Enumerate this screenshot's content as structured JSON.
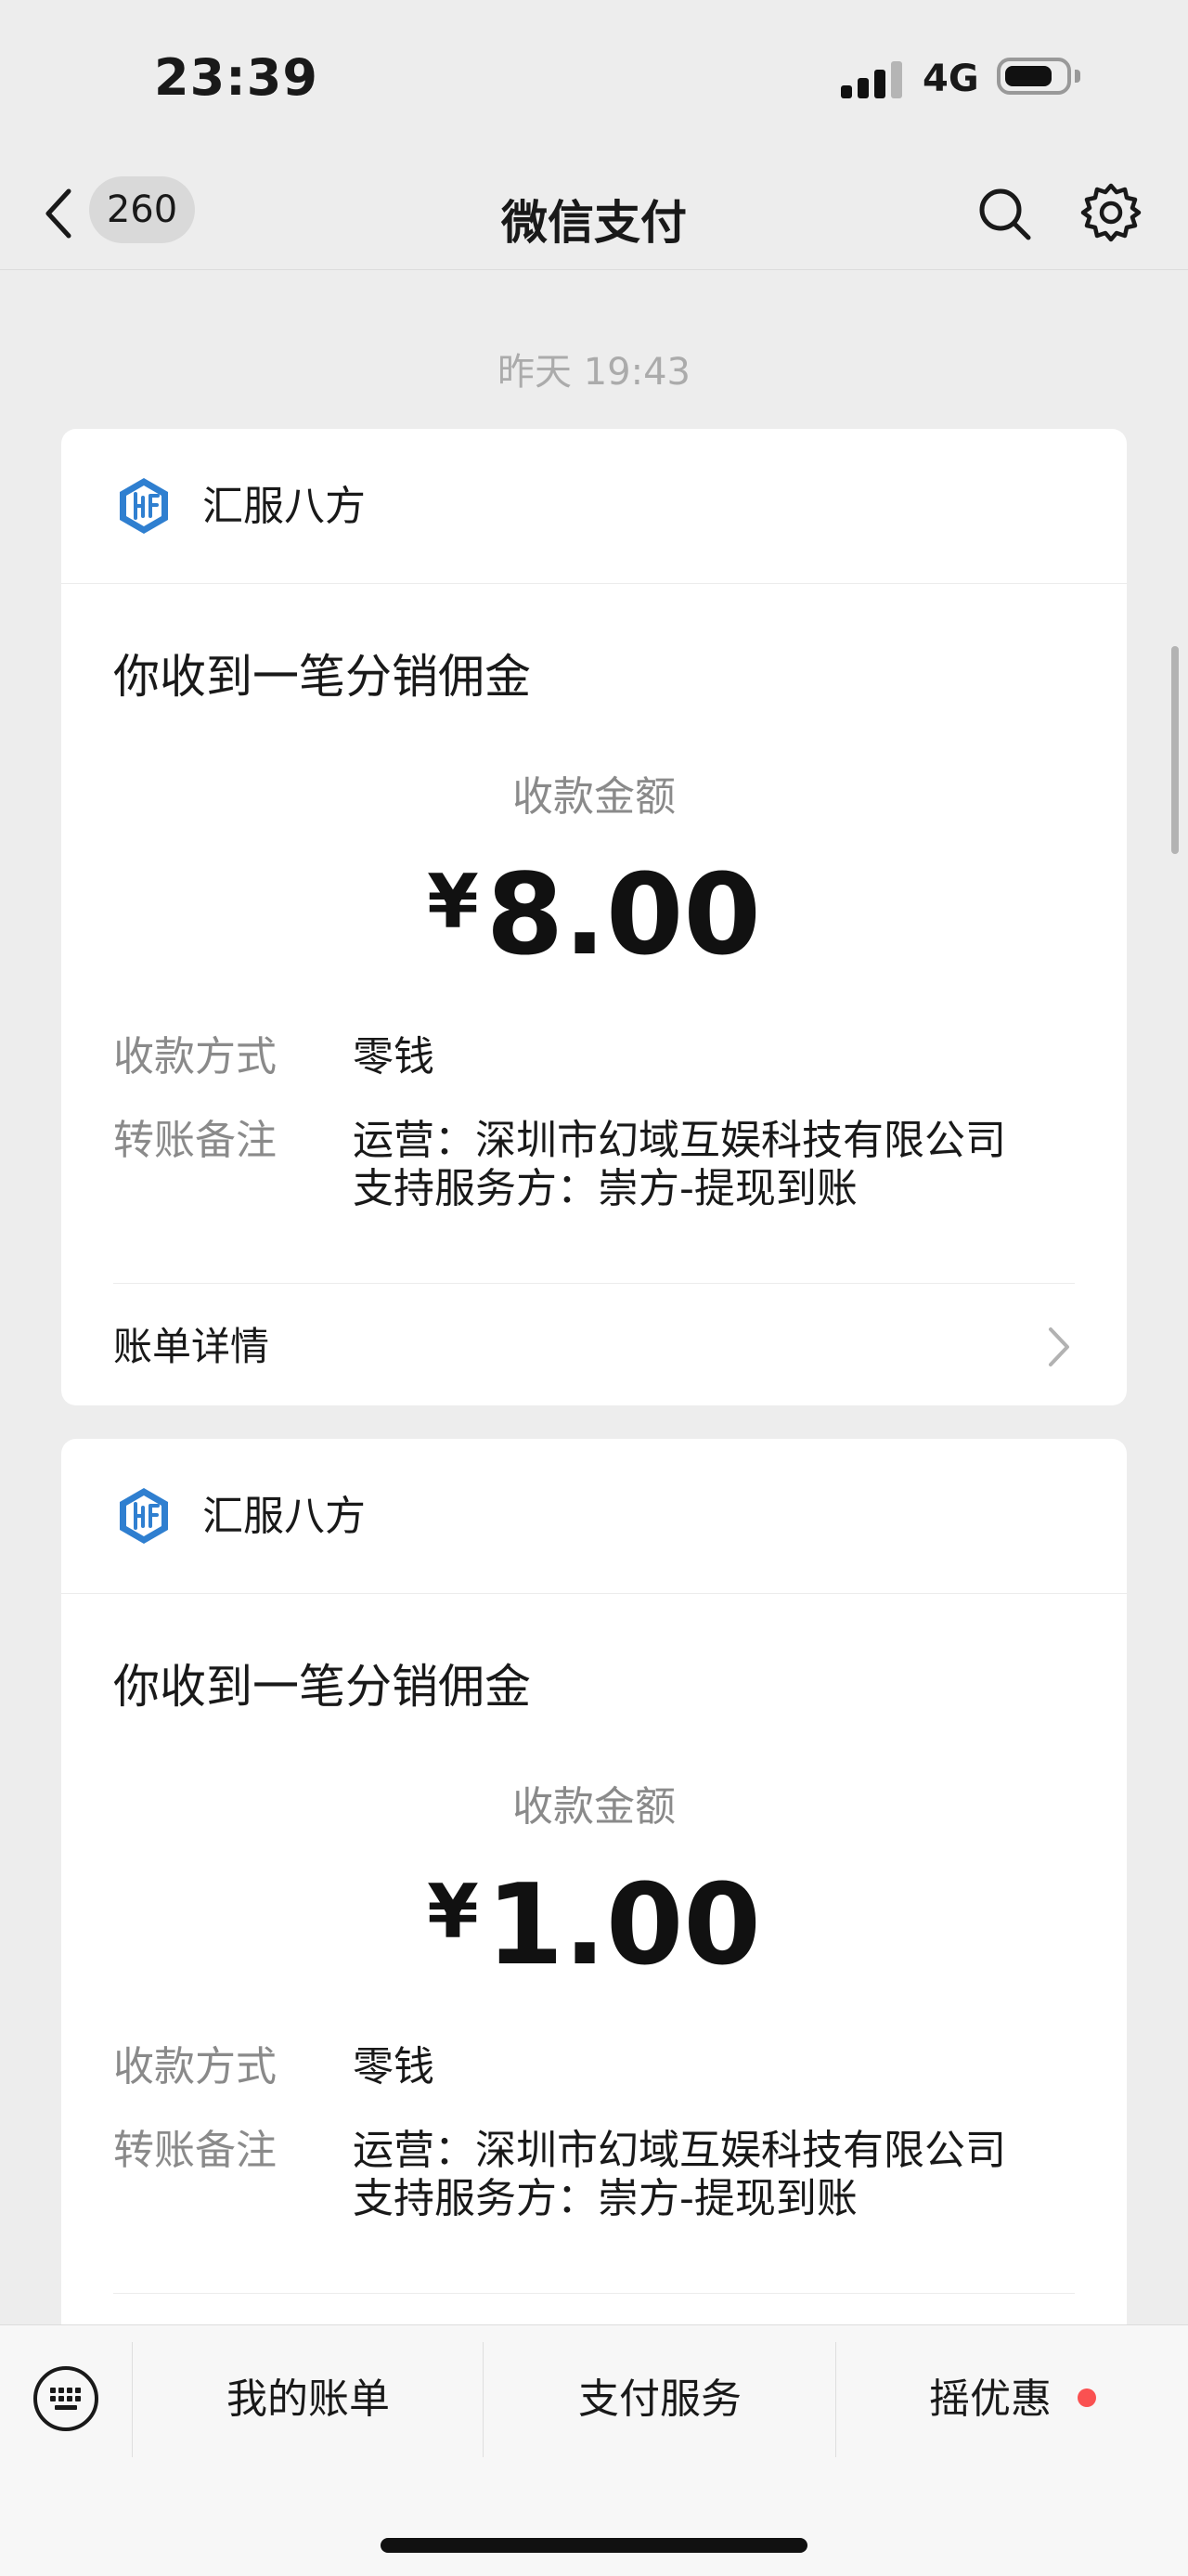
{
  "status_bar": {
    "time": "23:39",
    "network": "4G",
    "battery_level": 0.8
  },
  "nav": {
    "back_count": "260",
    "title": "微信支付"
  },
  "timestamp": "昨天 19:43",
  "cards": [
    {
      "merchant": "汇服八方",
      "title": "你收到一笔分销佣金",
      "amount_label": "收款金额",
      "currency": "¥",
      "amount": "8.00",
      "method_label": "收款方式",
      "method_value": "零钱",
      "note_label": "转账备注",
      "note_line1": "运营：深圳市幻域互娱科技有限公司",
      "note_line2": "支持服务方：崇方-提现到账",
      "detail_label": "账单详情"
    },
    {
      "merchant": "汇服八方",
      "title": "你收到一笔分销佣金",
      "amount_label": "收款金额",
      "currency": "¥",
      "amount": "1.00",
      "method_label": "收款方式",
      "method_value": "零钱",
      "note_label": "转账备注",
      "note_line1": "运营：深圳市幻域互娱科技有限公司",
      "note_line2": "支持服务方：崇方-提现到账"
    }
  ],
  "bottom_menu": {
    "items": [
      "我的账单",
      "支付服务",
      "摇优惠"
    ],
    "dot_color": "#fa5151"
  },
  "colors": {
    "background": "#ededed",
    "card": "#ffffff",
    "logo_blue": "#2f7fd0"
  },
  "icons": [
    "back-chevron-icon",
    "search-icon",
    "gear-icon",
    "merchant-logo-icon",
    "chevron-right-icon",
    "keyboard-icon"
  ]
}
